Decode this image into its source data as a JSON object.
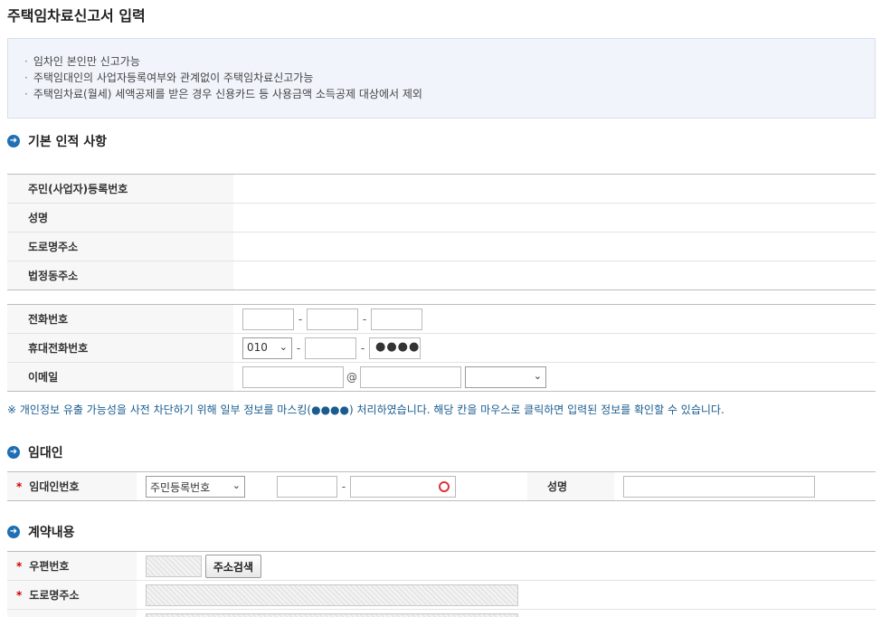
{
  "page": {
    "title": "주택임차료신고서 입력"
  },
  "notice": {
    "items": [
      "임차인 본인만 신고가능",
      "주택임대인의 사업자등록여부와 관계없이 주택임차료신고가능",
      "주택임차료(월세) 세액공제를 받은 경우 신용카드 등 사용금액 소득공제 대상에서 제외"
    ]
  },
  "basic": {
    "title": "기본 인적 사항",
    "rows": [
      "주민(사업자)등록번호",
      "성명",
      "도로명주소",
      "법정동주소"
    ],
    "phone_label": "전화번호",
    "mobile_label": "휴대전화번호",
    "mobile_prefix": "010",
    "mobile_masked": "●●●●",
    "email_label": "이메일",
    "email_at": "@"
  },
  "privacy_note": "※ 개인정보 유출 가능성을 사전 차단하기 위해 일부 정보를 마스킹(●●●●) 처리하였습니다. 해당 칸을 마우스로 클릭하면 입력된 정보를 확인할 수 있습니다.",
  "lessor": {
    "title": "임대인",
    "id_label": "임대인번호",
    "id_type": "주민등록번호",
    "name_label": "성명"
  },
  "contract": {
    "title": "계약내용",
    "zip_label": "우편번호",
    "address_search": "주소검색",
    "road_address_label": "도로명주소"
  },
  "required_mark": "*",
  "colors": {
    "section_icon": "#1f6fb4",
    "note_text": "#1a5c8f",
    "required": "#cc0000"
  }
}
